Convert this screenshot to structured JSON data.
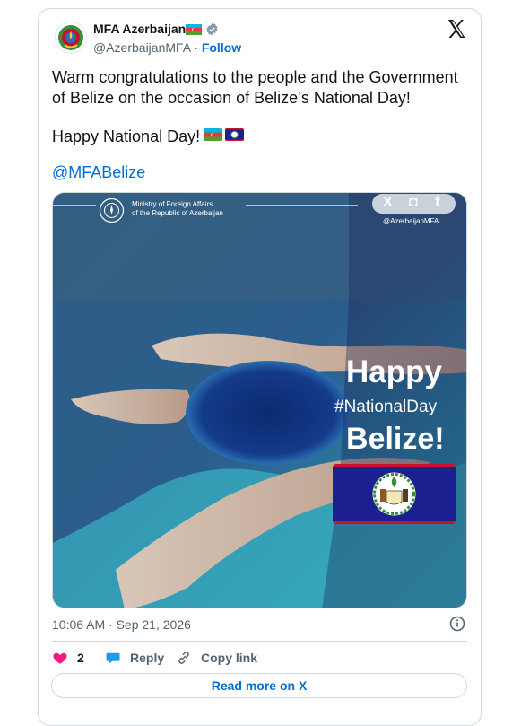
{
  "author": {
    "name": "MFA Azerbaijan",
    "handle": "@AzerbaijanMFA",
    "separator": " · ",
    "follow_label": "Follow"
  },
  "tweet": {
    "line1": "Warm congratulations to the people and the Government of Belize on the occasion of Belize’s National Day!",
    "line2": "Happy National Day!",
    "mention": "@MFABelize"
  },
  "media": {
    "ministry_line1": "Ministry of Foreign Affairs",
    "ministry_line2": "of the Republic of Azerbaijan",
    "social_x": "X",
    "social_instagram": "◘",
    "social_facebook": "f",
    "handle": "@AzerbaijanMFA",
    "happy": "Happy",
    "hashtag": "#NationalDay",
    "country": "Belize!"
  },
  "meta": {
    "timestamp": "10:06 AM · Sep 21, 2026"
  },
  "actions": {
    "likes": "2",
    "reply_label": "Reply",
    "copy_label": "Copy link"
  },
  "footer": {
    "read_more": "Read more on X"
  },
  "colors": {
    "link_blue": "#006fd6",
    "like_red": "#f91880",
    "belize_blue": "#1b1f8f",
    "belize_red": "#c8102e"
  },
  "icons": {
    "verified": "verified-badge-icon",
    "x_logo": "x-logo-icon",
    "info": "info-icon",
    "like": "heart-icon",
    "reply": "speech-bubble-icon",
    "copy": "link-icon"
  }
}
